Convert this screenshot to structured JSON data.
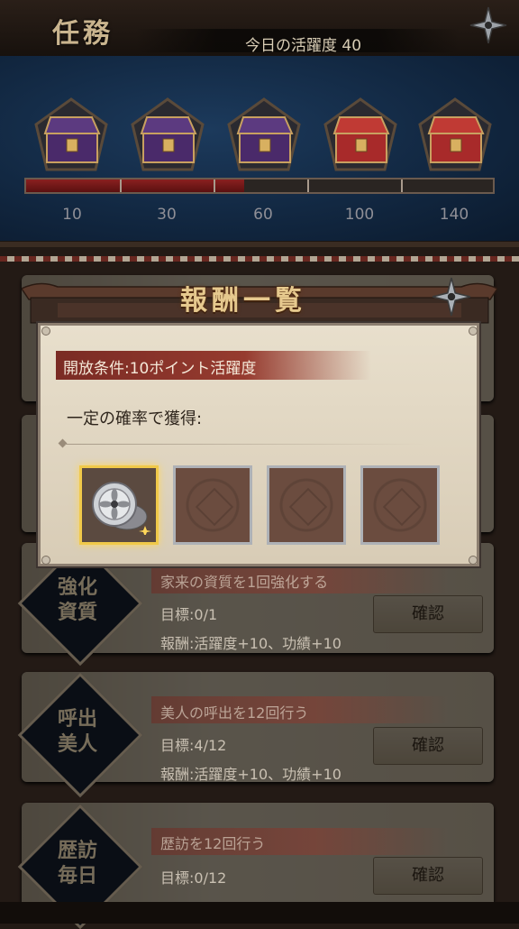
{
  "header": {
    "title": "任務",
    "activity_label": "今日の活躍度 40"
  },
  "progress": {
    "value": 40,
    "max": 140,
    "milestones": [
      "10",
      "30",
      "60",
      "100",
      "140"
    ],
    "chests": [
      {
        "icon": "purple-chest-icon"
      },
      {
        "icon": "purple-chest-icon"
      },
      {
        "icon": "purple-chest-icon"
      },
      {
        "icon": "red-chest-icon"
      },
      {
        "icon": "red-chest-icon"
      }
    ]
  },
  "modal": {
    "title": "報酬一覧",
    "condition": "開放条件:10ポイント活躍度",
    "subtitle": "一定の確率で獲得:",
    "reward_slots": [
      {
        "icon": "silver-coin-icon",
        "filled": true
      },
      {
        "icon": "empty-slot",
        "filled": false
      },
      {
        "icon": "empty-slot",
        "filled": false
      },
      {
        "icon": "empty-slot",
        "filled": false
      }
    ]
  },
  "tasks": [
    {
      "badge": "強化\n資質",
      "title": "家来の資質を1回強化する",
      "goal": "目標:0/1",
      "reward": "報酬:活躍度+10、功績+10",
      "button": "確認"
    },
    {
      "badge": "呼出\n美人",
      "title": "美人の呼出を12回行う",
      "goal": "目標:4/12",
      "reward": "報酬:活躍度+10、功績+10",
      "button": "確認"
    },
    {
      "badge": "歴訪\n毎日",
      "title": "歴訪を12回行う",
      "goal": "目標:0/12",
      "reward": "",
      "button": "確認"
    }
  ],
  "colors": {
    "accent_red": "#8d3a2e",
    "gold_highlight": "#f0c94a",
    "night_blue": "#122842"
  }
}
